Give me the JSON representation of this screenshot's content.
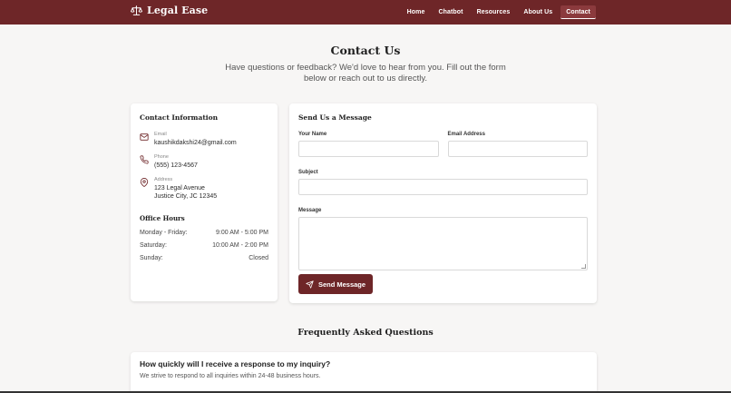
{
  "header": {
    "brand": "Legal Ease",
    "nav": [
      {
        "label": "Home"
      },
      {
        "label": "Chatbot"
      },
      {
        "label": "Resources"
      },
      {
        "label": "About Us"
      },
      {
        "label": "Contact",
        "active": true
      }
    ]
  },
  "hero": {
    "title": "Contact Us",
    "subtitle": "Have questions or feedback? We'd love to hear from you. Fill out the form below or reach out to us directly."
  },
  "contact_info": {
    "title": "Contact Information",
    "email_label": "Email",
    "email_value": "kaushikdakshi24@gmail.com",
    "phone_label": "Phone",
    "phone_value": "(555) 123-4567",
    "address_label": "Address",
    "address_line1": "123 Legal Avenue",
    "address_line2": "Justice City, JC 12345",
    "hours_title": "Office Hours",
    "hours": [
      {
        "day": "Monday - Friday:",
        "time": "9:00 AM - 5:00 PM"
      },
      {
        "day": "Saturday:",
        "time": "10:00 AM - 2:00 PM"
      },
      {
        "day": "Sunday:",
        "time": "Closed"
      }
    ]
  },
  "form": {
    "title": "Send Us a Message",
    "name_label": "Your Name",
    "email_label": "Email Address",
    "subject_label": "Subject",
    "message_label": "Message",
    "submit_label": "Send Message"
  },
  "faq": {
    "title": "Frequently Asked Questions",
    "items": [
      {
        "q": "How quickly will I receive a response to my inquiry?",
        "a": "We strive to respond to all inquiries within 24-48 business hours."
      }
    ]
  },
  "colors": {
    "brand": "#6e2628",
    "background": "#f7f6f5"
  }
}
